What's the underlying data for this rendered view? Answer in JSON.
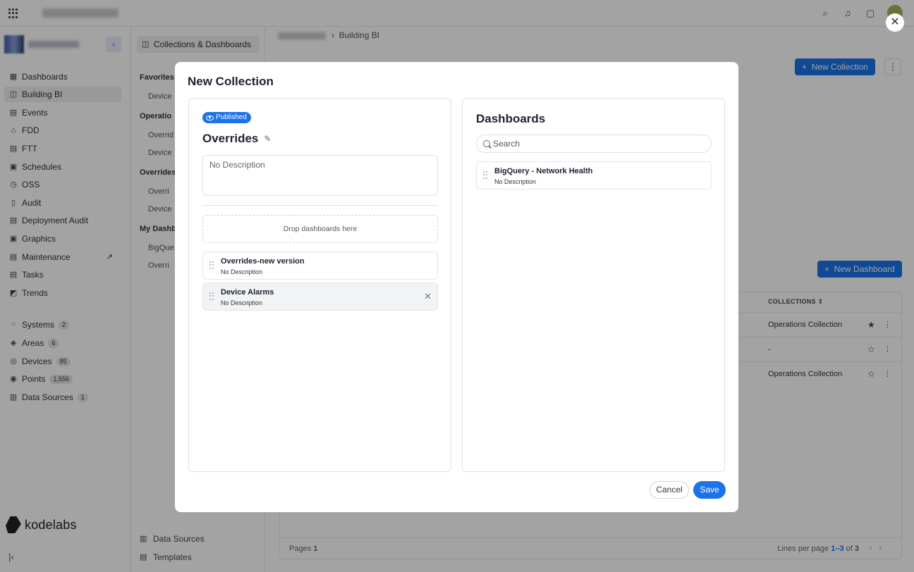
{
  "topbar": {
    "icons": [
      "apps-grid-icon",
      "search-icon",
      "bell-icon",
      "chat-icon",
      "user-avatar"
    ]
  },
  "sidebar": {
    "items": [
      {
        "label": "Dashboards",
        "icon": "dashboards-icon"
      },
      {
        "label": "Building BI",
        "icon": "chart-icon",
        "active": true
      },
      {
        "label": "Events",
        "icon": "events-icon"
      },
      {
        "label": "FDD",
        "icon": "fdd-icon"
      },
      {
        "label": "FTT",
        "icon": "ftt-icon"
      },
      {
        "label": "Schedules",
        "icon": "calendar-icon"
      },
      {
        "label": "OSS",
        "icon": "clock-icon"
      },
      {
        "label": "Audit",
        "icon": "audit-icon"
      },
      {
        "label": "Deployment Audit",
        "icon": "deployment-icon"
      },
      {
        "label": "Graphics",
        "icon": "graphics-icon"
      },
      {
        "label": "Maintenance",
        "icon": "maintenance-icon"
      },
      {
        "label": "Tasks",
        "icon": "tasks-icon"
      },
      {
        "label": "Trends",
        "icon": "trends-icon"
      }
    ],
    "resources": [
      {
        "label": "Systems",
        "count": "2"
      },
      {
        "label": "Areas",
        "count": "6"
      },
      {
        "label": "Devices",
        "count": "85"
      },
      {
        "label": "Points",
        "count": "1,556"
      },
      {
        "label": "Data Sources",
        "count": "1"
      }
    ],
    "brand": "kodelabs"
  },
  "subpanel": {
    "header": "Collections & Dashboards",
    "sections": [
      {
        "title": "Favorites",
        "items": [
          "Device"
        ]
      },
      {
        "title": "Operatio",
        "items": [
          "Overrid",
          "Device"
        ]
      },
      {
        "title": "Overrides",
        "items": [
          "Overri",
          "Device"
        ]
      },
      {
        "title": "My Dashb",
        "items": [
          "BigQue",
          "Overri"
        ]
      }
    ],
    "footer": [
      "Data Sources",
      "Templates"
    ]
  },
  "content": {
    "breadcrumb_current": "Building BI",
    "new_collection_label": "New Collection",
    "new_dashboard_label": "New Dashboard",
    "table": {
      "collections_header": "COLLECTIONS",
      "rows": [
        {
          "collection": "Operations Collection",
          "starred": true
        },
        {
          "collection": "-",
          "starred": false
        },
        {
          "collection": "Operations Collection",
          "starred": false
        }
      ],
      "pages_label": "Pages",
      "pages_value": "1",
      "lines_label": "Lines per page",
      "lines_range": "1–3",
      "lines_of": "of",
      "lines_total": "3"
    }
  },
  "modal": {
    "title": "New Collection",
    "status_badge": "Published",
    "collection_name": "Overrides",
    "description_placeholder": "No Description",
    "dropzone_label": "Drop dashboards here",
    "selected_dashboards": [
      {
        "name": "Overrides-new version",
        "description": "No Description"
      },
      {
        "name": "Device Alarms",
        "description": "No Description"
      }
    ],
    "dashboards_panel": {
      "title": "Dashboards",
      "search_placeholder": "Search",
      "items": [
        {
          "name": "BigQuery - Network Health",
          "description": "No Description"
        }
      ]
    },
    "cancel_label": "Cancel",
    "save_label": "Save"
  },
  "colors": {
    "accent": "#1a73e8",
    "overlay": "rgba(0,0,0,0.36)"
  }
}
